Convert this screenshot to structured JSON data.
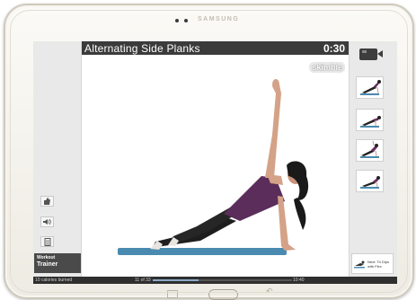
{
  "device": {
    "brand": "SAMSUNG"
  },
  "workout": {
    "exercise_title": "Alternating Side Planks",
    "timer": "0:30",
    "watermark": "skimble",
    "app_logo_line1": "Workout",
    "app_logo_line2": "Trainer"
  },
  "sidebar_right": {
    "camera_icon": "video-camera-icon",
    "thumbnail_count": 4,
    "next_up_text": "Next: Tri Dips with Flex"
  },
  "sidebar_left": {
    "controls": [
      "thumbs-up-icon",
      "volume-icon",
      "list-icon"
    ]
  },
  "progress": {
    "calories": "10 calories burned",
    "counter": "11 of 33",
    "remaining": "10:40",
    "fraction": 0.33
  },
  "colors": {
    "title_bar": "#3b3b3b",
    "mat": "#4a8ab0",
    "outfit_top": "#5b2d5b",
    "outfit_pants": "#1e1e1e"
  }
}
